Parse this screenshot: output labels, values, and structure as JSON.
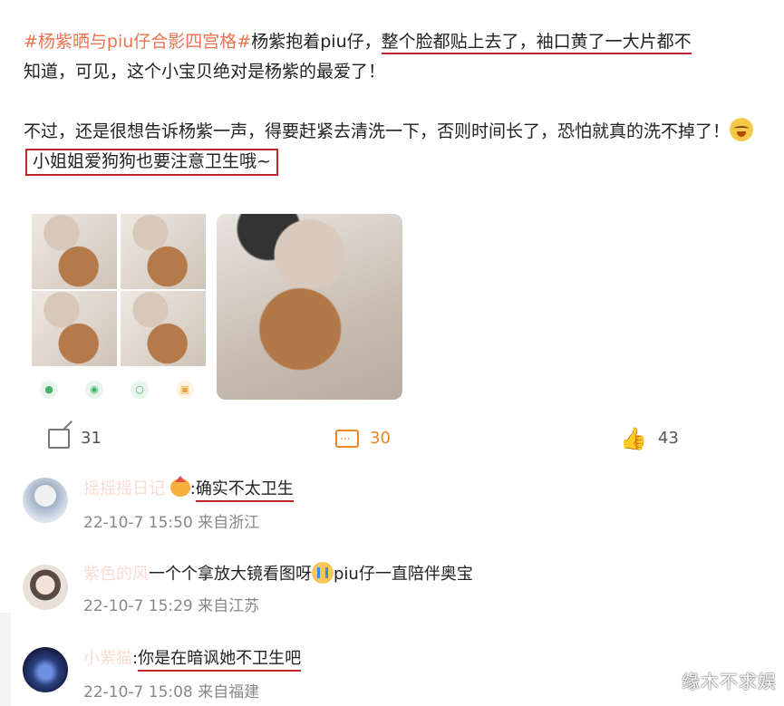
{
  "post": {
    "hashtag": "#杨紫晒与piu仔合影四宫格#",
    "text1": "杨紫抱着piu仔，",
    "underlined": "整个脸都贴上去了，袖口黄了一大片都不",
    "text2": "知道，可见，这个小宝贝绝对是杨紫的最爱了！",
    "para2": "不过，还是很想告诉杨紫一声，得要赶紧去清洗一下，否则时间长了，恐怕就真的洗不掉了！",
    "boxed": "小姐姐爱狗狗也要注意卫生哦~",
    "emoji": "laughing-crying-emoji"
  },
  "share_icons": [
    "wechat-icon",
    "moments-icon",
    "qq-icon",
    "bookmark-icon"
  ],
  "actions": {
    "share_count": "31",
    "comment_count": "30",
    "like_count": "43",
    "accent": "#e8862a"
  },
  "comments": [
    {
      "name": "摇摇摇日记",
      "text": "确实不太卫生",
      "meta": "22-10-7 15:50 来自浙江"
    },
    {
      "name": "紫色的风",
      "text_a": "一个个拿放大镜看图呀",
      "text_b": "piu仔一直陪伴奥宝",
      "meta": "22-10-7 15:29 来自江苏"
    },
    {
      "name": "小紫猫",
      "text": "你是在暗讽她不卫生吧",
      "meta": "22-10-7 15:08 来自福建"
    }
  ],
  "watermark": "缘木不求娱",
  "colors": {
    "hashtag": "#eb7350",
    "highlight_red": "#c0262b"
  }
}
